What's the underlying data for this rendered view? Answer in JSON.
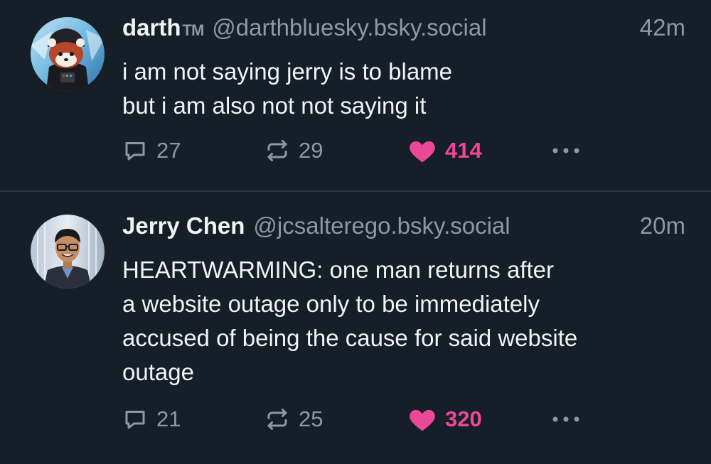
{
  "posts": [
    {
      "display_name": "darth",
      "display_badge": "TM",
      "handle": "@darthbluesky.bsky.social",
      "time": "42m",
      "text": "i am not saying jerry is to blame\nbut i am also not not saying it",
      "reply_count": "27",
      "repost_count": "29",
      "like_count": "414",
      "liked": true,
      "avatar": "red-panda-darth-vader-avatar"
    },
    {
      "display_name": "Jerry Chen",
      "handle": "@jcsalterego.bsky.social",
      "time": "20m",
      "text": "HEARTWARMING: one man returns after\na website outage only to be immediately\naccused of being the cause for said website\noutage",
      "reply_count": "21",
      "repost_count": "25",
      "like_count": "320",
      "liked": true,
      "avatar": "man-with-glasses-avatar"
    }
  ],
  "colors": {
    "background": "#161e27",
    "text": "#f1f3f5",
    "muted": "#8c98a8",
    "like": "#ec4899",
    "divider": "#2a333e"
  },
  "icons": {
    "reply": "speech-bubble-icon",
    "repost": "repost-arrows-icon",
    "like": "heart-icon",
    "more": "ellipsis-icon"
  }
}
